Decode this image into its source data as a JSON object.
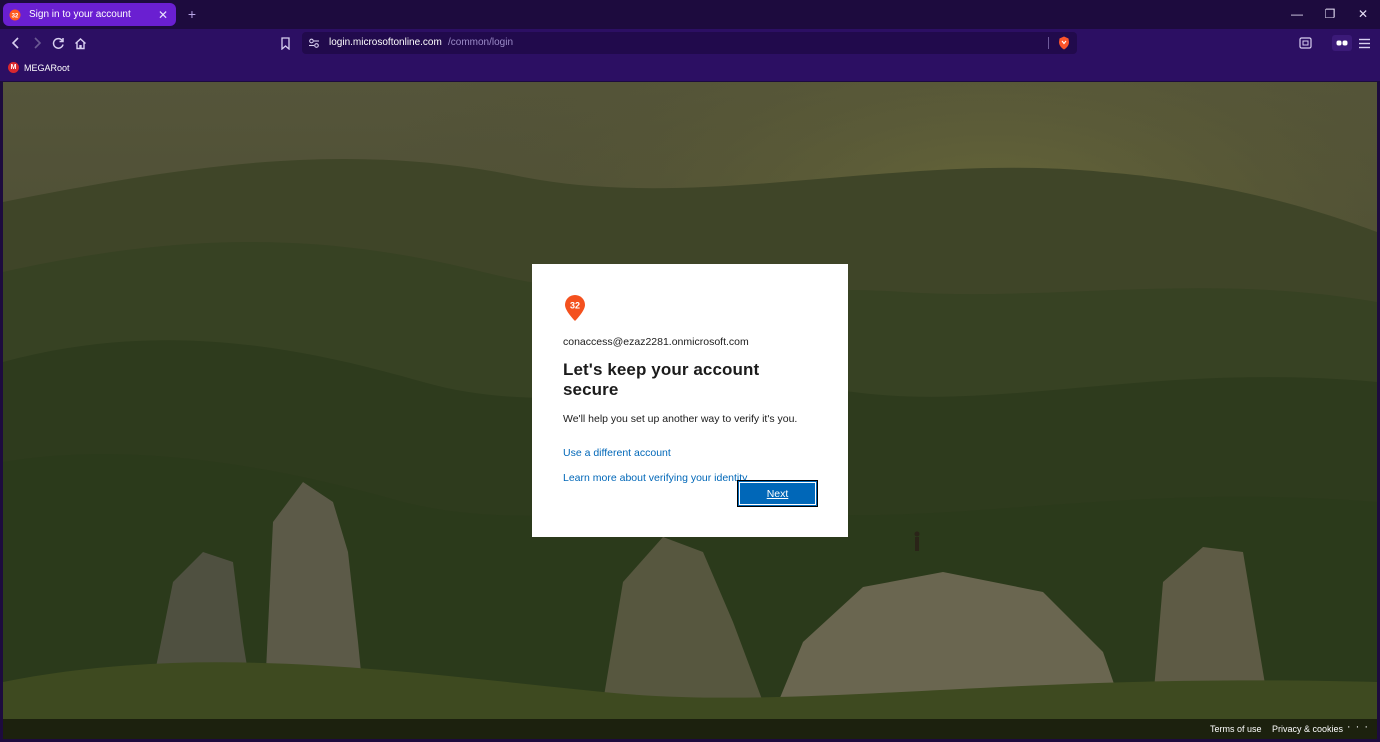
{
  "browser": {
    "tab": {
      "title": "Sign in to your account",
      "close": "✕"
    },
    "new_tab": "+",
    "window_controls": {
      "minimize": "—",
      "restore": "❐",
      "close": "✕"
    },
    "url": {
      "host": "login.microsoftonline.com",
      "path": "/common/login"
    },
    "bookmarks": [
      {
        "label": "MEGARoot",
        "icon": "M"
      }
    ]
  },
  "card": {
    "logo_text": "32",
    "email": "conaccess@ezaz2281.onmicrosoft.com",
    "heading": "Let's keep your account secure",
    "description": "We'll help you set up another way to verify it's you.",
    "links": {
      "different_account": "Use a different account",
      "learn_more": "Learn more about verifying your identity"
    },
    "next_button": "Next"
  },
  "footer": {
    "terms": "Terms of use",
    "privacy": "Privacy & cookies",
    "more": "· · ·"
  },
  "colors": {
    "tab_active": "#6a1fd1",
    "toolbar": "#2c0f63",
    "link": "#0067b8",
    "button": "#0067b8"
  }
}
